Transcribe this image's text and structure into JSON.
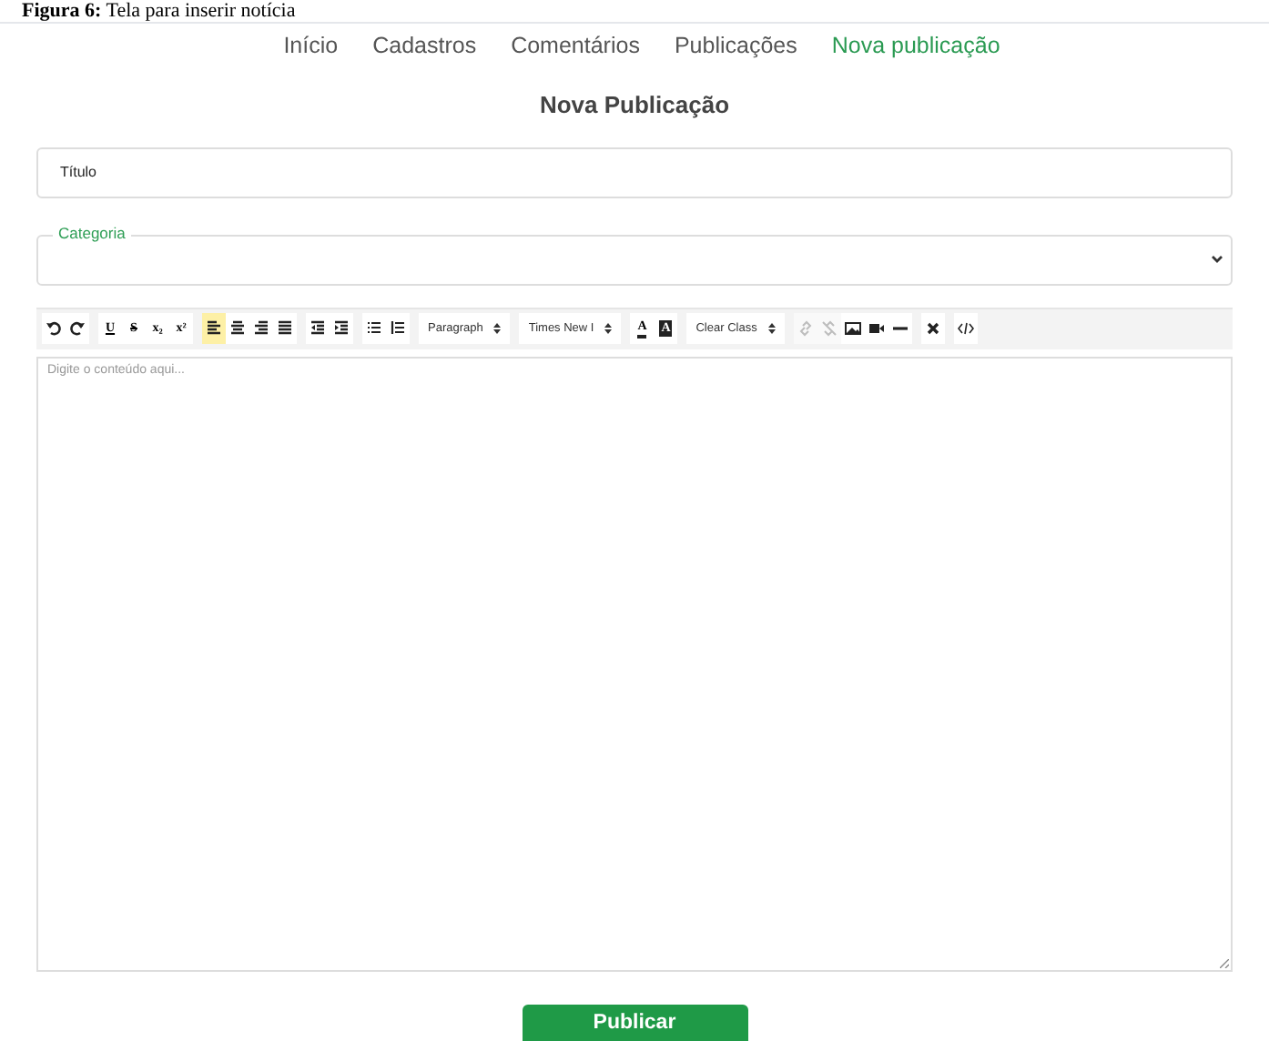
{
  "caption": "**Figura 6:** Tela para inserir notícia",
  "nav": [
    {
      "label": "Início",
      "selected": false
    },
    {
      "label": "Cadastros",
      "selected": false
    },
    {
      "label": "Comentários",
      "selected": false
    },
    {
      "label": "Publicações",
      "selected": false
    },
    {
      "label": "Nova publicação",
      "selected": true
    }
  ],
  "heading": "Nova Publicação",
  "title_field": {
    "placeholder": "Título"
  },
  "category_field": {
    "label": "Categoria"
  },
  "toolbar": [
    [
      {
        "kind": "icon"
      },
      {
        "kind": "icon"
      }
    ],
    [
      {
        "kind": "glyph",
        "glyph": "U"
      },
      {
        "kind": "glyph",
        "glyph": "S"
      },
      {
        "kind": "glyph",
        "glyph": "x₂"
      },
      {
        "kind": "glyph",
        "glyph": "x²"
      }
    ],
    [
      {
        "kind": "icon",
        "selected": true
      },
      {
        "kind": "icon",
        "selected": false
      },
      {
        "kind": "icon",
        "selected": false
      },
      {
        "kind": "icon",
        "selected": false
      }
    ],
    [
      {
        "kind": "icon"
      },
      {
        "kind": "icon"
      }
    ],
    [
      {
        "kind": "icon"
      },
      {
        "kind": "icon"
      }
    ],
    [
      {
        "kind": "select",
        "label": "Paragraph"
      }
    ],
    [
      {
        "kind": "select",
        "label": "Times New I"
      }
    ],
    [
      {
        "kind": "glyph",
        "glyph": "A"
      },
      {
        "kind": "glyph",
        "glyph": "A"
      }
    ],
    [
      {
        "kind": "select",
        "label": "Clear Class"
      }
    ],
    [
      {
        "kind": "icon",
        "disabled": true
      },
      {
        "kind": "icon",
        "disabled": true
      },
      {
        "kind": "icon",
        "disabled": false
      },
      {
        "kind": "icon",
        "disabled": false
      },
      {
        "kind": "icon",
        "disabled": false
      }
    ],
    [
      {
        "kind": "icon"
      }
    ],
    [
      {
        "kind": "icon"
      }
    ]
  ],
  "editor": {
    "placeholder": "Digite o conteúdo aqui..."
  },
  "submit": "Publicar"
}
